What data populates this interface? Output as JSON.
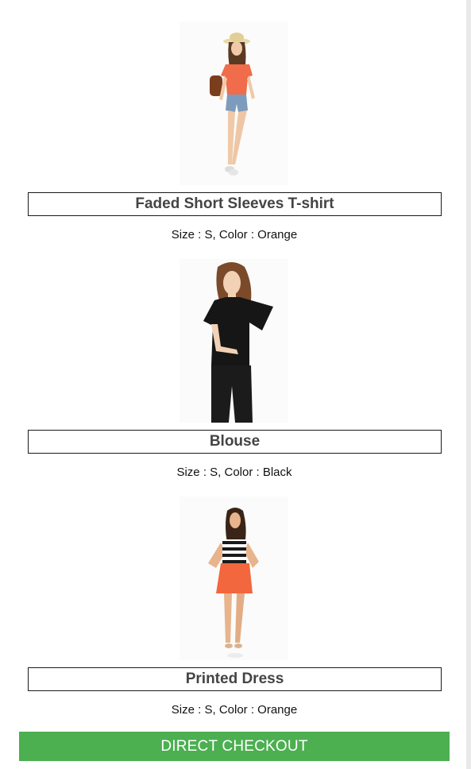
{
  "products": [
    {
      "name": "Faded Short Sleeves T-shirt",
      "specs": "Size : S, Color : Orange"
    },
    {
      "name": "Blouse",
      "specs": "Size : S, Color : Black"
    },
    {
      "name": "Printed Dress",
      "specs": "Size : S, Color : Orange"
    }
  ],
  "checkout": {
    "label": "DIRECT CHECKOUT",
    "color": "#4caf50"
  }
}
